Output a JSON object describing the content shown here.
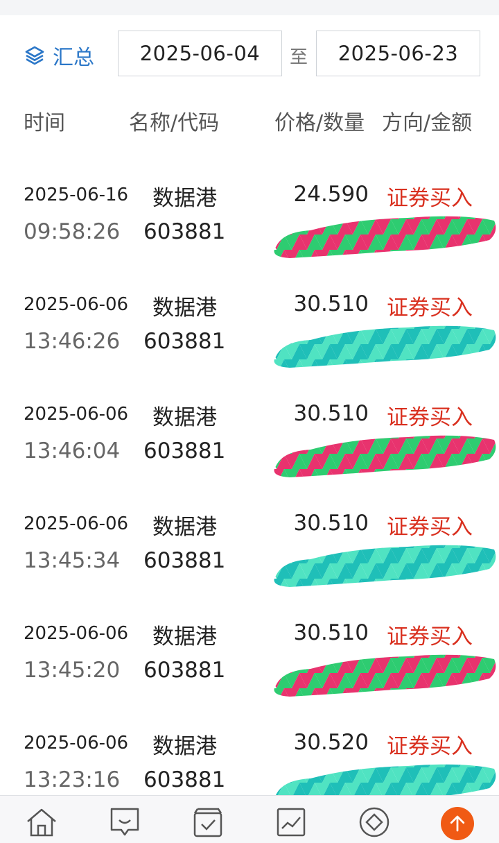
{
  "filter": {
    "summary_label": "汇总",
    "start_date": "2025-06-04",
    "to_label": "至",
    "end_date": "2025-06-23"
  },
  "columns": {
    "time": "时间",
    "name_code": "名称/代码",
    "price_qty": "价格/数量",
    "dir_amount": "方向/金额"
  },
  "records": [
    {
      "date": "2025-06-16",
      "time": "09:58:26",
      "name": "数据港",
      "code": "603881",
      "price": "24.590",
      "direction": "证券买入"
    },
    {
      "date": "2025-06-06",
      "time": "13:46:26",
      "name": "数据港",
      "code": "603881",
      "price": "30.510",
      "direction": "证券买入"
    },
    {
      "date": "2025-06-06",
      "time": "13:46:04",
      "name": "数据港",
      "code": "603881",
      "price": "30.510",
      "direction": "证券买入"
    },
    {
      "date": "2025-06-06",
      "time": "13:45:34",
      "name": "数据港",
      "code": "603881",
      "price": "30.510",
      "direction": "证券买入"
    },
    {
      "date": "2025-06-06",
      "time": "13:45:20",
      "name": "数据港",
      "code": "603881",
      "price": "30.510",
      "direction": "证券买入"
    },
    {
      "date": "2025-06-06",
      "time": "13:23:16",
      "name": "数据港",
      "code": "603881",
      "price": "30.520",
      "direction": "证券买入"
    }
  ],
  "tabbar": {
    "icons": [
      "home-icon",
      "message-icon",
      "orders-icon",
      "market-icon",
      "trade-icon",
      "scroll-top-icon"
    ],
    "accent_color": "#f05a14"
  },
  "colors": {
    "link_blue": "#2b77c8",
    "buy_red": "#d9301f"
  }
}
